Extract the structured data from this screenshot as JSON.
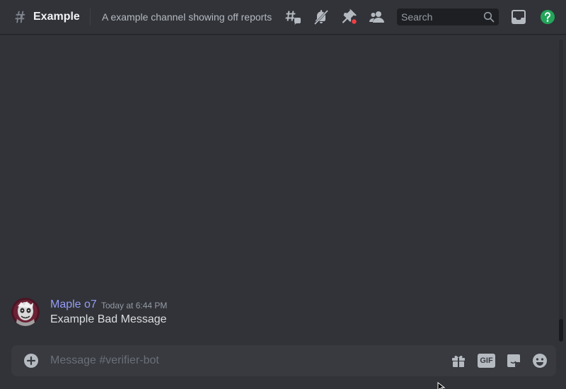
{
  "header": {
    "channel_name": "Example",
    "topic": "A example channel showing off reports",
    "icons": [
      "hashtag-icon",
      "threads-icon",
      "notification-muted-icon",
      "pinned-messages-icon",
      "member-list-icon",
      "inbox-icon",
      "help-icon"
    ],
    "search": {
      "placeholder": "Search"
    },
    "pins_badge_color": "#f23f43",
    "help_color": "#23a55a"
  },
  "messages": [
    {
      "username": "Maple o7",
      "timestamp": "Today at 6:44 PM",
      "content": "Example Bad Message",
      "username_color": "#949cf7"
    }
  ],
  "composer": {
    "placeholder": "Message #verifier-bot",
    "gif_label": "GIF",
    "icons": [
      "add-attachment-icon",
      "gift-icon",
      "gif-icon",
      "sticker-icon",
      "emoji-icon"
    ]
  },
  "colors": {
    "background": "#313338",
    "composer": "#383a40",
    "text": "#dbdee1",
    "muted": "#b5bac1"
  }
}
